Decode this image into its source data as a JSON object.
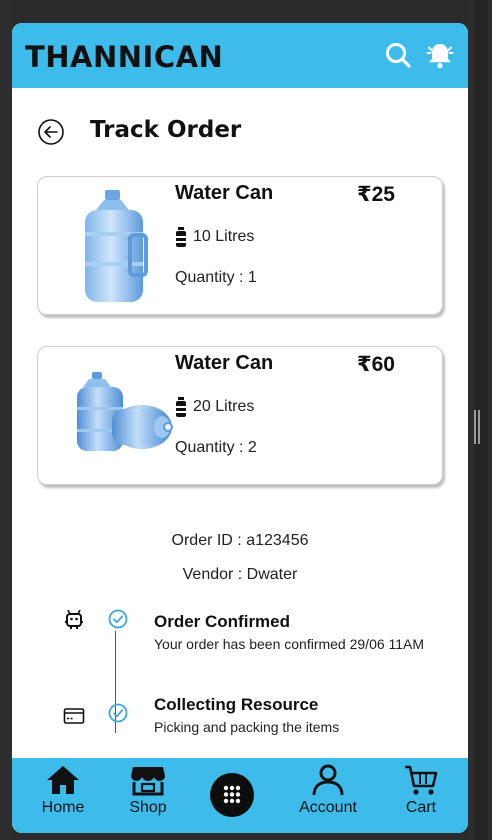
{
  "header": {
    "brand": "THANNICAN",
    "search_icon": "search-icon",
    "notification_icon": "bell-icon",
    "accent_color": "#3dbcec"
  },
  "page": {
    "back_icon": "back-arrow-icon",
    "title": "Track Order"
  },
  "items": [
    {
      "name": "Water Can",
      "price": "₹25",
      "volume": "10 Litres",
      "quantity": "Quantity : 1",
      "image": "water-can-image"
    },
    {
      "name": "Water Can",
      "price": "₹60",
      "volume": "20 Litres",
      "quantity": "Quantity : 2",
      "image": "water-cans-image"
    }
  ],
  "order": {
    "order_id": "Order ID : a123456",
    "vendor": "Vendor : Dwater"
  },
  "timeline": [
    {
      "title": "Order Confirmed",
      "subtitle": "Your order has been confirmed 29/06 11AM",
      "icon": "robot-icon",
      "status_icon": "check-circle-icon"
    },
    {
      "title": "Collecting Resource",
      "subtitle": "Picking and packing the items",
      "icon": "card-icon",
      "status_icon": "check-circle-icon"
    }
  ],
  "nav": {
    "home": "Home",
    "shop": "Shop",
    "menu_icon": "grid-menu-icon",
    "account": "Account",
    "cart": "Cart"
  }
}
